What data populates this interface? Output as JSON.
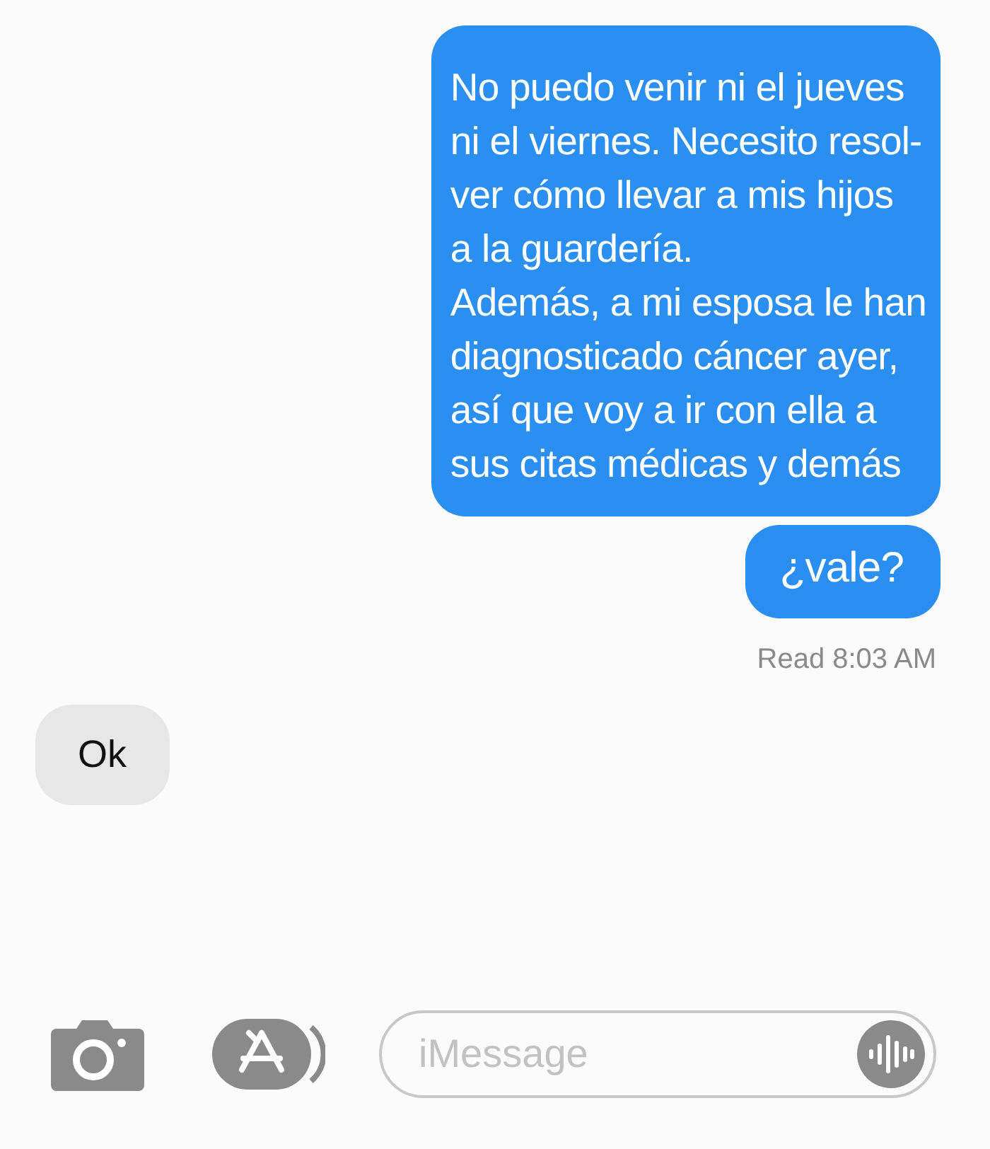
{
  "messages": [
    {
      "kind": "sent",
      "text": "No puedo venir ni el jueves\nni el viernes. Necesito resol-\nver cómo llevar a mis hijos\na la guardería.\nAdemás, a mi esposa le han\ndiagnosticado cáncer ayer,\nasí que voy a ir con ella a\nsus citas médicas y demás"
    },
    {
      "kind": "sent",
      "text": "¿vale?"
    },
    {
      "kind": "receipt",
      "text": "Read 8:03 AM"
    },
    {
      "kind": "received",
      "text": "Ok"
    }
  ],
  "composer": {
    "placeholder": "iMessage"
  }
}
